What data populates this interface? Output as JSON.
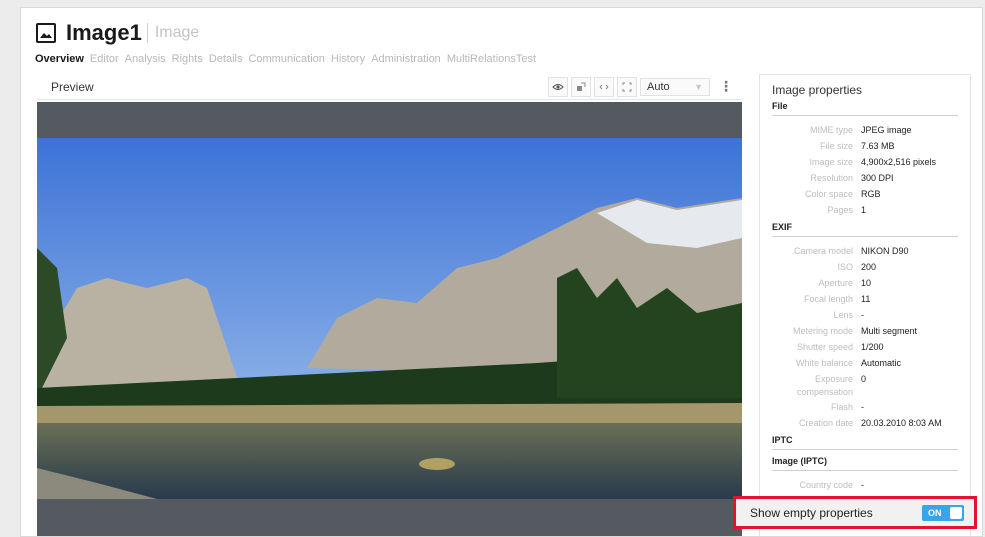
{
  "header": {
    "title": "Image1",
    "subtitle": "Image",
    "tabs": [
      {
        "label": "Overview",
        "active": true
      },
      {
        "label": "Editor"
      },
      {
        "label": "Analysis"
      },
      {
        "label": "Rights"
      },
      {
        "label": "Details"
      },
      {
        "label": "Communication"
      },
      {
        "label": "History"
      },
      {
        "label": "Administration"
      },
      {
        "label": "MultiRelationsTest"
      }
    ]
  },
  "preview": {
    "title": "Preview",
    "zoom_value": "Auto"
  },
  "properties": {
    "title": "Image properties",
    "file_header": "File",
    "file": [
      {
        "key": "MIME type",
        "value": "JPEG image"
      },
      {
        "key": "File size",
        "value": "7.63 MB"
      },
      {
        "key": "Image size",
        "value": "4,900x2,516 pixels"
      },
      {
        "key": "Resolution",
        "value": "300 DPI"
      },
      {
        "key": "Color space",
        "value": "RGB"
      },
      {
        "key": "Pages",
        "value": "1"
      }
    ],
    "exif_header": "EXIF",
    "exif": [
      {
        "key": "Camera model",
        "value": "NIKON D90"
      },
      {
        "key": "ISO",
        "value": "200"
      },
      {
        "key": "Aperture",
        "value": "10"
      },
      {
        "key": "Focal length",
        "value": "11"
      },
      {
        "key": "Lens",
        "value": "-"
      },
      {
        "key": "Metering mode",
        "value": "Multi segment"
      },
      {
        "key": "Shutter speed",
        "value": "1/200"
      },
      {
        "key": "White balance",
        "value": "Automatic"
      },
      {
        "key": "Exposure compensation",
        "value": "0"
      },
      {
        "key": "Flash",
        "value": "-"
      },
      {
        "key": "Creation date",
        "value": "20.03.2010 8:03 AM"
      }
    ],
    "iptc_header": "IPTC",
    "iptc_sub_header": "Image (IPTC)",
    "iptc": [
      {
        "key": "Country code",
        "value": "-"
      }
    ]
  },
  "footer": {
    "show_empty_label": "Show empty properties",
    "toggle_state": "ON"
  },
  "colors": {
    "accent": "#3aa5e6",
    "highlight": "#e8112d"
  }
}
